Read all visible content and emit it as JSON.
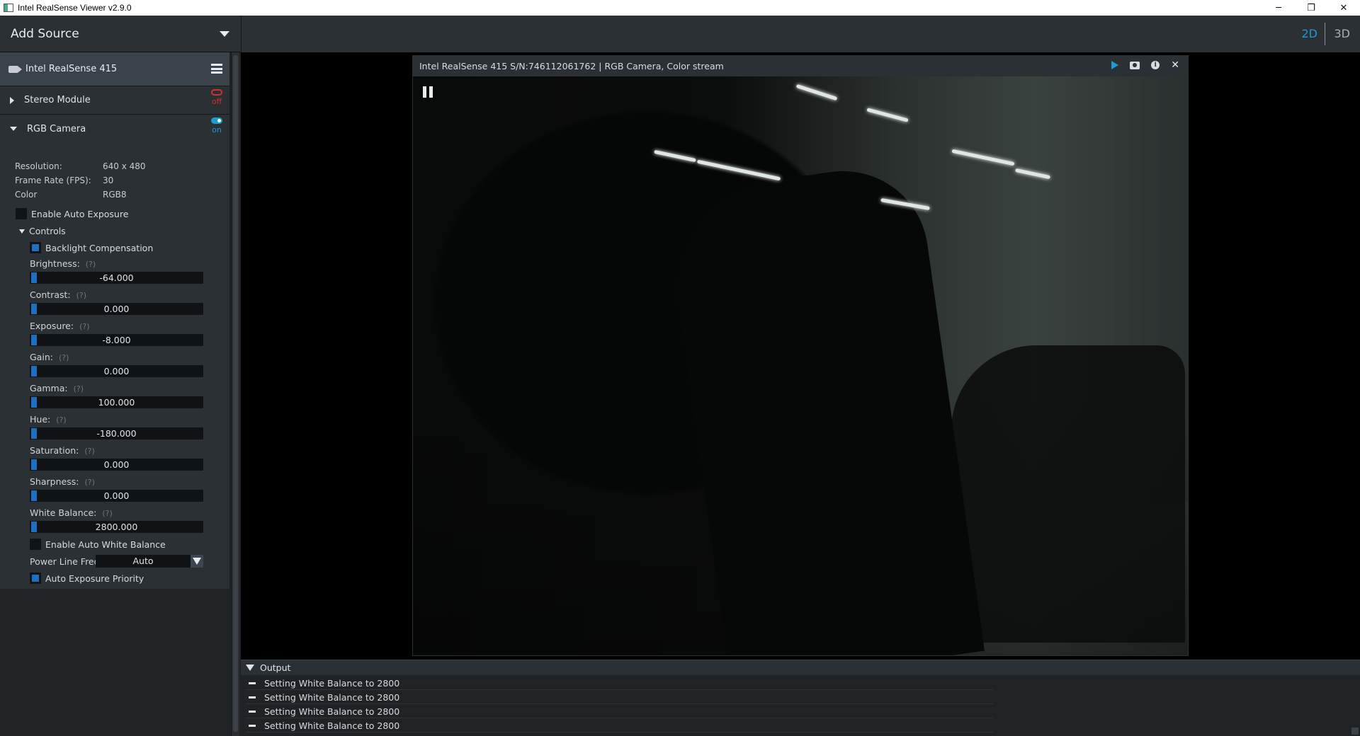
{
  "window": {
    "title": "Intel RealSense Viewer v2.9.0",
    "minimize": "─",
    "restore": "❐",
    "close": "✕"
  },
  "sidebar": {
    "add_source": "Add Source",
    "device_name": "Intel RealSense 415",
    "sensors": [
      {
        "name": "Stereo Module",
        "state": "off",
        "expanded": false
      },
      {
        "name": "RGB Camera",
        "state": "on",
        "expanded": true
      }
    ],
    "rgb": {
      "resolution_label": "Resolution:",
      "resolution_value": "640 x 480",
      "fps_label": "Frame Rate (FPS):",
      "fps_value": "30",
      "color_label": "Color",
      "color_value": "RGB8",
      "auto_exposure_label": "Enable Auto Exposure",
      "auto_exposure_checked": false,
      "controls_label": "Controls",
      "backlight_label": "Backlight Compensation",
      "backlight_checked": true,
      "help": "(?)",
      "sliders": [
        {
          "label": "Brightness:",
          "value": "-64.000"
        },
        {
          "label": "Contrast:",
          "value": "0.000"
        },
        {
          "label": "Exposure:",
          "value": "-8.000"
        },
        {
          "label": "Gain:",
          "value": "0.000"
        },
        {
          "label": "Gamma:",
          "value": "100.000"
        },
        {
          "label": "Hue:",
          "value": "-180.000"
        },
        {
          "label": "Saturation:",
          "value": "0.000"
        },
        {
          "label": "Sharpness:",
          "value": "0.000"
        },
        {
          "label": "White Balance:",
          "value": "2800.000"
        }
      ],
      "auto_wb_label": "Enable Auto White Balance",
      "auto_wb_checked": false,
      "power_line_label": "Power Line Frequency",
      "power_line_value": "Auto",
      "ae_priority_label": "Auto Exposure Priority",
      "ae_priority_checked": true
    }
  },
  "view_modes": {
    "mode_2d": "2D",
    "mode_3d": "3D",
    "active": "2D"
  },
  "stream": {
    "title": "Intel RealSense 415 S/N:746112061762 | RGB Camera, Color stream",
    "icons": [
      "play-icon",
      "camera-icon",
      "info-icon",
      "close-icon"
    ]
  },
  "output": {
    "title": "Output",
    "logs": [
      "Setting White Balance to 2800",
      "Setting White Balance to 2800",
      "Setting White Balance to 2800",
      "Setting White Balance to 2800"
    ]
  },
  "colors": {
    "accent": "#1e9ad6",
    "off": "#d03030",
    "panel": "#2b3035",
    "slider_knob": "#1e6fc0"
  }
}
